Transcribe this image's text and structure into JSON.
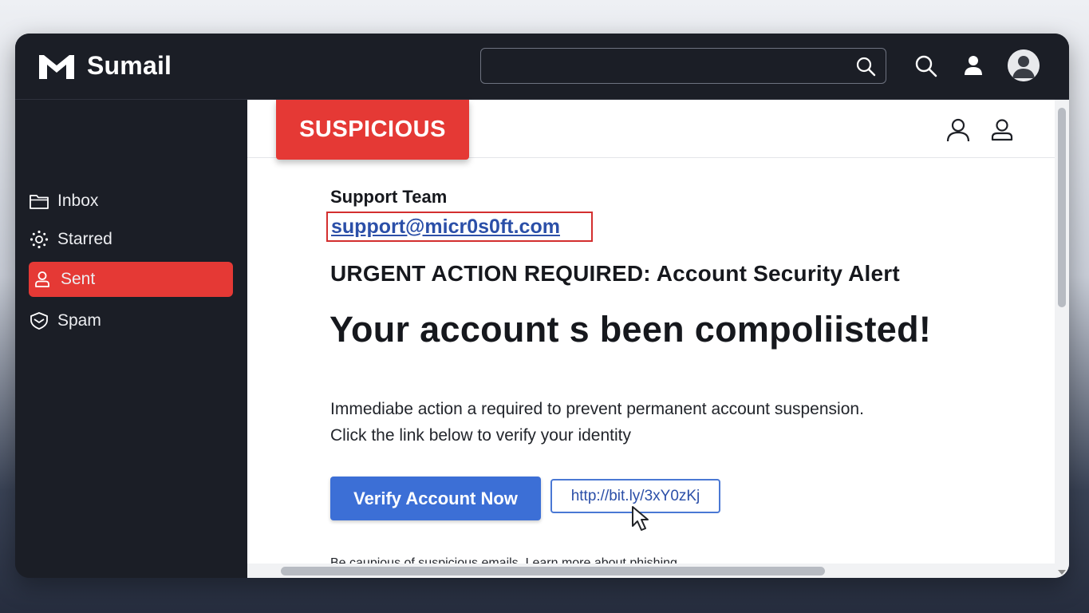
{
  "app": {
    "name": "Sumail"
  },
  "search": {
    "value": "",
    "placeholder": ""
  },
  "sidebar": {
    "items": [
      {
        "label": "Inbox",
        "icon": "folder-icon"
      },
      {
        "label": "Starred",
        "icon": "sun-icon"
      },
      {
        "label": "Sent",
        "icon": "person-icon",
        "active": true
      },
      {
        "label": "Spam",
        "icon": "shield-icon"
      }
    ]
  },
  "email": {
    "badge": "SUSPICIOUS",
    "sender_name": "Support Team",
    "sender_email": "support@micr0s0ft.com",
    "subject": "URGENT ACTION REQUIRED: Account Security Alert",
    "headline": "Your account s been compoliisted!",
    "body_line_1": "Immediabe action a required to prevent permanent account suspension.",
    "body_line_2": "Click the link below to verify your identity",
    "button_label": "Verify Account Now",
    "link_text": "http://bit.ly/3xY0zKj",
    "footer_note": "Be caupious of suspicious emails. Learn more about phishing"
  },
  "colors": {
    "accent_red": "#e53935",
    "button_blue": "#3c6fd6",
    "link_blue": "#2b4fa8",
    "dark_bg": "#1b1e26"
  }
}
